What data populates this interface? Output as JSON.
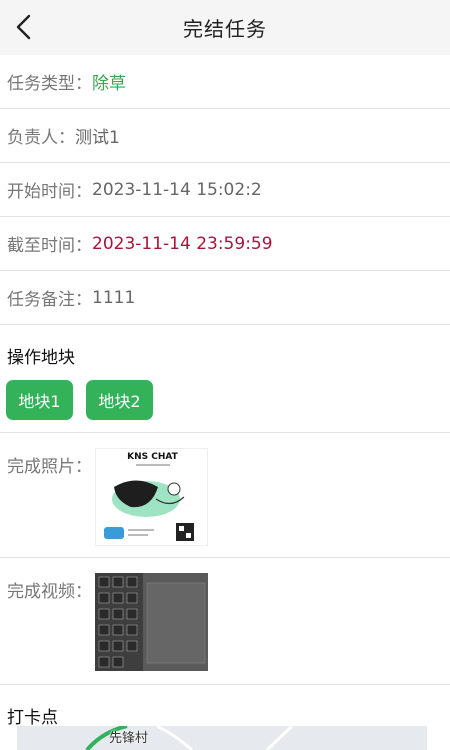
{
  "header": {
    "title": "完结任务"
  },
  "task": {
    "type_label": "任务类型：",
    "type_value": "除草",
    "owner_label": "负责人：",
    "owner_value": "测试1",
    "start_label": "开始时间：",
    "start_value": "2023-11-14 15:02:2",
    "deadline_label": "截至时间：",
    "deadline_value": "2023-11-14 23:59:59",
    "note_label": "任务备注：",
    "note_value": "1111"
  },
  "plots": {
    "title": "操作地块",
    "items": [
      {
        "label": "地块1"
      },
      {
        "label": "地块2"
      }
    ]
  },
  "media": {
    "photo_label": "完成照片：",
    "photo_caption": "KNS CHAT",
    "video_label": "完成视频："
  },
  "checkin": {
    "title": "打卡点",
    "map_label": "先锋村"
  },
  "colors": {
    "accent_green": "#33b25a",
    "deadline_red": "#a8153a",
    "header_bg": "#f5f5f5"
  },
  "icons": {
    "back": "chevron-left-icon"
  }
}
